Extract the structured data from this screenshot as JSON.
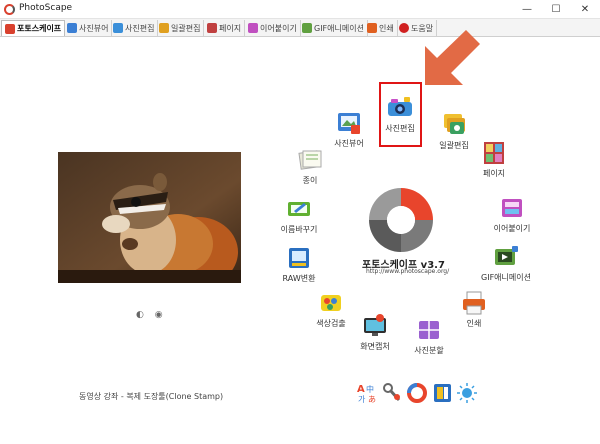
{
  "window": {
    "title": "PhotoScape",
    "minimize_glyph": "—",
    "maximize_glyph": "☐",
    "close_glyph": "✕"
  },
  "tabs": [
    {
      "label": "포토스케이프",
      "icon": "photoscape-home-icon",
      "color": "#d9412e",
      "active": true
    },
    {
      "label": "사진뷰어",
      "icon": "photo-viewer-icon",
      "color": "#3b7fd4"
    },
    {
      "label": "사진편집",
      "icon": "photo-editor-icon",
      "color": "#3b8fd9"
    },
    {
      "label": "일괄편집",
      "icon": "batch-editor-icon",
      "color": "#e0a020"
    },
    {
      "label": "페이지",
      "icon": "page-icon",
      "color": "#c04040"
    },
    {
      "label": "이어붙이기",
      "icon": "combine-icon",
      "color": "#c050c0"
    },
    {
      "label": "GIF애니메이션",
      "icon": "animated-gif-icon",
      "color": "#60a040"
    },
    {
      "label": "인쇄",
      "icon": "print-icon",
      "color": "#e06020"
    },
    {
      "label": "도움말",
      "icon": "help-icon",
      "color": "#d02020"
    }
  ],
  "photo_controls": "◐ ◉",
  "tip_text": "동영상 강좌 - 복제 도장툴(Clone Stamp)",
  "brand": {
    "name": "포토스케이프 v3.7",
    "url": "http://www.photoscape.org/"
  },
  "menu": [
    {
      "key": "viewer",
      "label": "사진뷰어",
      "icon": "photo-viewer-icon"
    },
    {
      "key": "editor",
      "label": "사진편집",
      "icon": "photo-editor-icon"
    },
    {
      "key": "batch",
      "label": "일괄편집",
      "icon": "batch-editor-icon"
    },
    {
      "key": "page",
      "label": "페이지",
      "icon": "page-icon"
    },
    {
      "key": "combine",
      "label": "이어붙이기",
      "icon": "combine-icon"
    },
    {
      "key": "gif",
      "label": "GIF애니메이션",
      "icon": "animated-gif-icon"
    },
    {
      "key": "print",
      "label": "인쇄",
      "icon": "print-icon"
    },
    {
      "key": "splitter",
      "label": "사진분할",
      "icon": "splitter-icon"
    },
    {
      "key": "screen",
      "label": "화면캡처",
      "icon": "screen-capture-icon"
    },
    {
      "key": "picker",
      "label": "색상검출",
      "icon": "color-picker-icon"
    },
    {
      "key": "raw",
      "label": "RAW변환",
      "icon": "raw-converter-icon"
    },
    {
      "key": "rename",
      "label": "이름바꾸기",
      "icon": "rename-icon"
    },
    {
      "key": "paper",
      "label": "종이",
      "icon": "paper-icon"
    }
  ],
  "bottom_tools": [
    {
      "icon": "language-icon"
    },
    {
      "icon": "tools-icon"
    },
    {
      "icon": "photoscape-x-icon"
    },
    {
      "icon": "photo-filter-icon"
    },
    {
      "icon": "weather-icon"
    }
  ],
  "colors": {
    "highlight_box": "#e01515",
    "arrow": "#e26a45",
    "logo_orange": "#e8452c",
    "logo_gray": "#5a5a5a"
  }
}
